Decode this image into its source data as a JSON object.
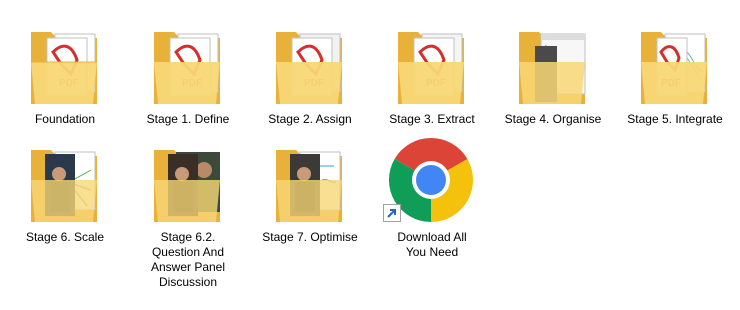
{
  "desktop": {
    "items": [
      {
        "label": "Foundation",
        "type": "folder",
        "preview": "pdf"
      },
      {
        "label": "Stage 1. Define",
        "type": "folder",
        "preview": "pdf"
      },
      {
        "label": "Stage 2. Assign",
        "type": "folder",
        "preview": "pdf"
      },
      {
        "label": "Stage 3. Extract",
        "type": "folder",
        "preview": "pdf"
      },
      {
        "label": "Stage 4. Organise",
        "type": "folder",
        "preview": "document"
      },
      {
        "label": "Stage 5. Integrate",
        "type": "folder",
        "preview": "pdf"
      },
      {
        "label": "Stage 6. Scale",
        "type": "folder",
        "preview": "video"
      },
      {
        "label": "Stage 6.2.\nQuestion And\nAnswer  Panel\nDiscussion",
        "type": "folder",
        "preview": "video"
      },
      {
        "label": "Stage 7. Optimise",
        "type": "folder",
        "preview": "video"
      },
      {
        "label": "Download All\nYou Need",
        "type": "shortcut",
        "preview": "chrome-icon"
      }
    ]
  },
  "colors": {
    "folder_back": "#E8B13A",
    "folder_front": "#F8D775",
    "pdf_red": "#D32F2F",
    "chrome_red": "#DB4437",
    "chrome_yellow": "#F4C20D",
    "chrome_green": "#0F9D58",
    "chrome_blue": "#4285F4"
  }
}
